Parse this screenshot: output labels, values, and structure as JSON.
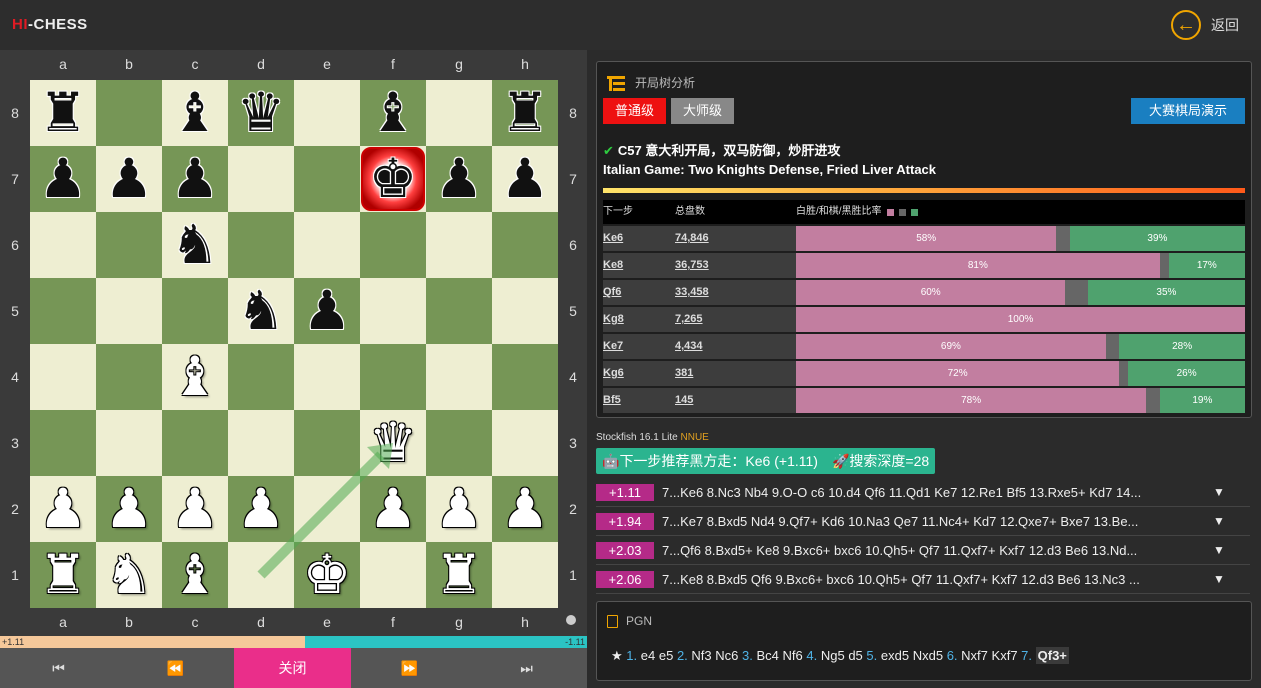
{
  "app": {
    "logo_hi": "HI",
    "logo_rest": "-CHESS",
    "back_label": "返回"
  },
  "board": {
    "files": [
      "a",
      "b",
      "c",
      "d",
      "e",
      "f",
      "g",
      "h"
    ],
    "ranks": [
      "8",
      "7",
      "6",
      "5",
      "4",
      "3",
      "2",
      "1"
    ],
    "position": [
      [
        "bR",
        "",
        "bB",
        "bQ",
        "",
        "bB",
        "",
        "bR"
      ],
      [
        "bP",
        "bP",
        "bP",
        "",
        "",
        "bK",
        "bP",
        "bP"
      ],
      [
        "",
        "",
        "bN",
        "",
        "",
        "",
        "",
        ""
      ],
      [
        "",
        "",
        "",
        "bN",
        "bP",
        "",
        "",
        ""
      ],
      [
        "",
        "",
        "wB",
        "",
        "",
        "",
        "",
        ""
      ],
      [
        "",
        "",
        "",
        "",
        "",
        "wQ",
        "",
        ""
      ],
      [
        "wP",
        "wP",
        "wP",
        "wP",
        "",
        "wP",
        "wP",
        "wP"
      ],
      [
        "wR",
        "wN",
        "wB",
        "",
        "wK",
        "",
        "wR",
        ""
      ]
    ],
    "checked_square": "f7",
    "last_move_arrow": {
      "from": "d1",
      "to": "f3"
    }
  },
  "eval_bar": {
    "white_label": "+1.11",
    "black_label": "-1.11",
    "white_share": 0.52
  },
  "controls": {
    "first": "first-icon",
    "prev": "prev-icon",
    "close_label": "关闭",
    "next": "next-icon",
    "last": "last-icon"
  },
  "explorer": {
    "title": "开局树分析",
    "level_normal": "普通级",
    "level_master": "大师级",
    "demo_button": "大赛棋局演示",
    "opening_zh": "C57 意大利开局，双马防御，炒肝进攻",
    "opening_en": "Italian Game: Two Knights Defense, Fried Liver Attack",
    "col_move": "下一步",
    "col_total": "总盘数",
    "col_ratio": "白胜/和棋/黑胜比率",
    "colors": {
      "white": "#c27ea0",
      "draw": "#666666",
      "black": "#4fa26e"
    },
    "rows": [
      {
        "move": "Ke6",
        "total": "74,846",
        "white": 58,
        "draw": 3,
        "black": 39,
        "white_label": "58%",
        "black_label": "39%"
      },
      {
        "move": "Ke8",
        "total": "36,753",
        "white": 81,
        "draw": 2,
        "black": 17,
        "white_label": "81%",
        "black_label": "17%"
      },
      {
        "move": "Qf6",
        "total": "33,458",
        "white": 60,
        "draw": 5,
        "black": 35,
        "white_label": "60%",
        "black_label": "35%"
      },
      {
        "move": "Kg8",
        "total": "7,265",
        "white": 100,
        "draw": 0,
        "black": 0,
        "white_label": "100%",
        "black_label": ""
      },
      {
        "move": "Ke7",
        "total": "4,434",
        "white": 69,
        "draw": 3,
        "black": 28,
        "white_label": "69%",
        "black_label": "28%"
      },
      {
        "move": "Kg6",
        "total": "381",
        "white": 72,
        "draw": 2,
        "black": 26,
        "white_label": "72%",
        "black_label": "26%"
      },
      {
        "move": "Bf5",
        "total": "145",
        "white": 78,
        "draw": 3,
        "black": 19,
        "white_label": "78%",
        "black_label": "19%"
      }
    ]
  },
  "engine": {
    "name": "Stockfish 16.1 Lite",
    "flavor": "NNUE",
    "recommend": "下一步推荐黑方走：Ke6 (+1.11)",
    "depth": "搜索深度=28",
    "lines": [
      {
        "eval": "+1.11",
        "pv": "7...Ke6 8.Nc3 Nb4 9.O-O c6 10.d4 Qf6 11.Qd1 Ke7 12.Re1 Bf5 13.Rxe5+ Kd7 14..."
      },
      {
        "eval": "+1.94",
        "pv": "7...Ke7 8.Bxd5 Nd4 9.Qf7+ Kd6 10.Na3 Qe7 11.Nc4+ Kd7 12.Qxe7+ Bxe7 13.Be..."
      },
      {
        "eval": "+2.03",
        "pv": "7...Qf6 8.Bxd5+ Ke8 9.Bxc6+ bxc6 10.Qh5+ Qf7 11.Qxf7+ Kxf7 12.d3 Be6 13.Nd..."
      },
      {
        "eval": "+2.06",
        "pv": "7...Ke8 8.Bxd5 Qf6 9.Bxc6+ bxc6 10.Qh5+ Qf7 11.Qxf7+ Kxf7 12.d3 Be6 13.Nc3 ..."
      }
    ]
  },
  "pgn": {
    "title": "PGN",
    "moves": [
      {
        "n": "1.",
        "w": "e4",
        "b": "e5"
      },
      {
        "n": "2.",
        "w": "Nf3",
        "b": "Nc6"
      },
      {
        "n": "3.",
        "w": "Bc4",
        "b": "Nf6"
      },
      {
        "n": "4.",
        "w": "Ng5",
        "b": "d5"
      },
      {
        "n": "5.",
        "w": "exd5",
        "b": "Nxd5"
      },
      {
        "n": "6.",
        "w": "Nxf7",
        "b": "Kxf7"
      },
      {
        "n": "7.",
        "w": "Qf3+",
        "b": ""
      }
    ]
  }
}
